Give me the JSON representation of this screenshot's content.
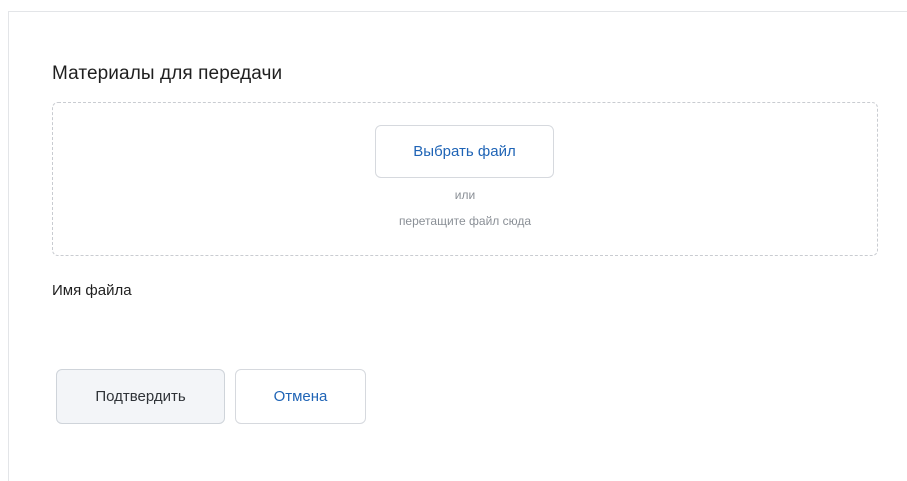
{
  "section": {
    "title": "Материалы для передачи"
  },
  "upload": {
    "choose_file_label": "Выбрать файл",
    "or_label": "или",
    "drag_hint": "перетащите файл сюда"
  },
  "file": {
    "name_label": "Имя файла"
  },
  "actions": {
    "confirm_label": "Подтвердить",
    "cancel_label": "Отмена"
  },
  "colors": {
    "accent": "#1f64b6",
    "border": "#d6d9de",
    "muted_text": "#8a8f96",
    "confirm_bg": "#f3f5f8"
  }
}
